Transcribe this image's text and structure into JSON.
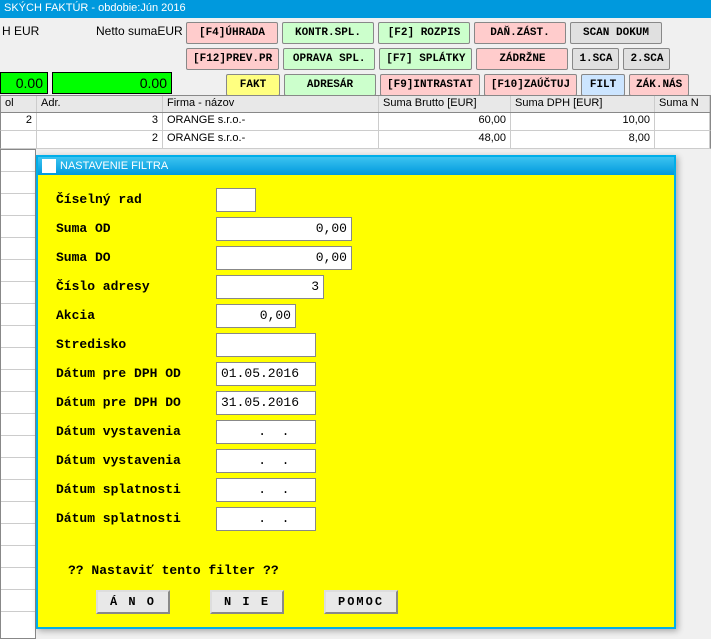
{
  "window": {
    "title": "SKÝCH FAKTÚR - obdobie:Jún 2016"
  },
  "header": {
    "label1": "H  EUR",
    "label2": "Netto sumaEUR",
    "sum1": "0.00",
    "sum2": "0.00"
  },
  "toolbar": {
    "r1": {
      "b1": "[F4]ÚHRADA",
      "b2": "KONTR.SPL.",
      "b3": "[F2] ROZPIS",
      "b4": "DAŇ.ZÁST.",
      "b5": "SCAN DOKUM"
    },
    "r2": {
      "b1": "[F12]PREV.PR",
      "b2": "OPRAVA SPL.",
      "b3": "[F7] SPLÁTKY",
      "b4": "ZÁDRŽNE",
      "b5": "1.SCA",
      "b6": "2.SCA"
    },
    "r3": {
      "b1": "FAKT",
      "b2": "ADRESÁR",
      "b3": "[F9]INTRASTAT",
      "b4": "[F10]ZAÚČTUJ",
      "b5": "FILT",
      "b6": "ZÁK.NÁS"
    }
  },
  "table": {
    "headers": {
      "col1": "ol",
      "col2": "Adr.",
      "col3": "Firma - názov",
      "col4": "Suma Brutto [EUR]",
      "col5": "Suma DPH [EUR]",
      "col6": "Suma N"
    },
    "rows": [
      {
        "c1": "2",
        "c2": "3",
        "c3": "ORANGE s.r.o.-",
        "c4": "60,00",
        "c5": "10,00",
        "c6": ""
      },
      {
        "c1": "",
        "c2": "2",
        "c3": "ORANGE s.r.o.-",
        "c4": "48,00",
        "c5": "8,00",
        "c6": ""
      }
    ]
  },
  "dialog": {
    "title": "NASTAVENIE FILTRA",
    "fields": {
      "ciselny_rad": {
        "label": "Číselný rad",
        "value": ""
      },
      "suma_od": {
        "label": "Suma OD",
        "value": "0,00"
      },
      "suma_do": {
        "label": "Suma DO",
        "value": "0,00"
      },
      "cislo_adresy": {
        "label": "Číslo adresy",
        "value": "3"
      },
      "akcia": {
        "label": "Akcia",
        "value": "0,00"
      },
      "stredisko": {
        "label": "Stredisko",
        "value": ""
      },
      "datum_dph_od": {
        "label": "Dátum pre DPH OD",
        "value": "01.05.2016"
      },
      "datum_dph_do": {
        "label": "Dátum pre DPH DO",
        "value": "31.05.2016"
      },
      "datum_vyst1": {
        "label": "Dátum vystavenia",
        "value": "  .  ."
      },
      "datum_vyst2": {
        "label": "Dátum vystavenia",
        "value": "  .  ."
      },
      "datum_splat1": {
        "label": "Dátum splatnosti",
        "value": "  .  ."
      },
      "datum_splat2": {
        "label": "Dátum splatnosti",
        "value": "  .  ."
      }
    },
    "question": "?? Nastaviť tento filter ??",
    "buttons": {
      "yes": "Á N O",
      "no": "N I E",
      "help": "POMOC"
    }
  }
}
